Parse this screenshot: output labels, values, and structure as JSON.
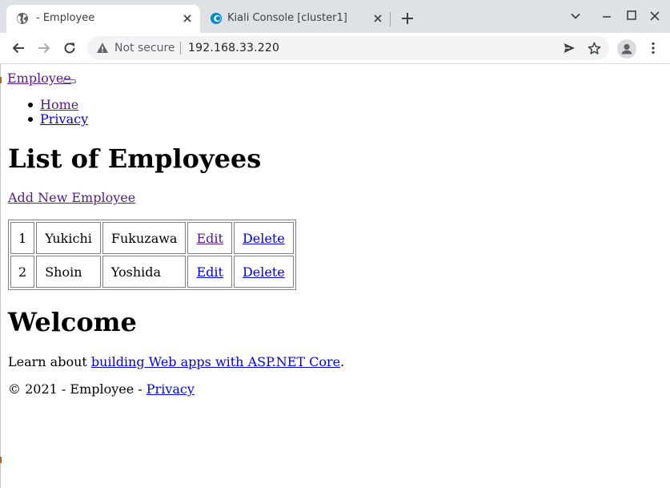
{
  "browser": {
    "tabs": [
      {
        "title": " - Employee",
        "favicon": "globe-icon",
        "active": true
      },
      {
        "title": "Kiali Console [cluster1]",
        "favicon": "kiali-icon",
        "active": false
      }
    ],
    "security_label": "Not secure",
    "url": "192.168.33.220"
  },
  "page": {
    "brand": "Employee",
    "nav": [
      "Home",
      "Privacy"
    ],
    "list_heading": "List of Employees",
    "add_link": "Add New Employee",
    "employees": [
      {
        "id": "1",
        "first": "Yukichi",
        "last": "Fukuzawa",
        "edit": "Edit",
        "delete": "Delete"
      },
      {
        "id": "2",
        "first": "Shoin",
        "last": "Yoshida",
        "edit": "Edit",
        "delete": "Delete"
      }
    ],
    "welcome_heading": "Welcome",
    "learn_prefix": "Learn about ",
    "learn_link": "building Web apps with ASP.NET Core",
    "learn_suffix": ".",
    "footer_text": "© 2021 - Employee - ",
    "footer_link": "Privacy"
  },
  "colors": {
    "tabstrip": "#dee1e6",
    "omnibox": "#f1f3f4",
    "link": "#0000ee",
    "visited_link": "#551a8b",
    "kiali": "#0088ce"
  }
}
